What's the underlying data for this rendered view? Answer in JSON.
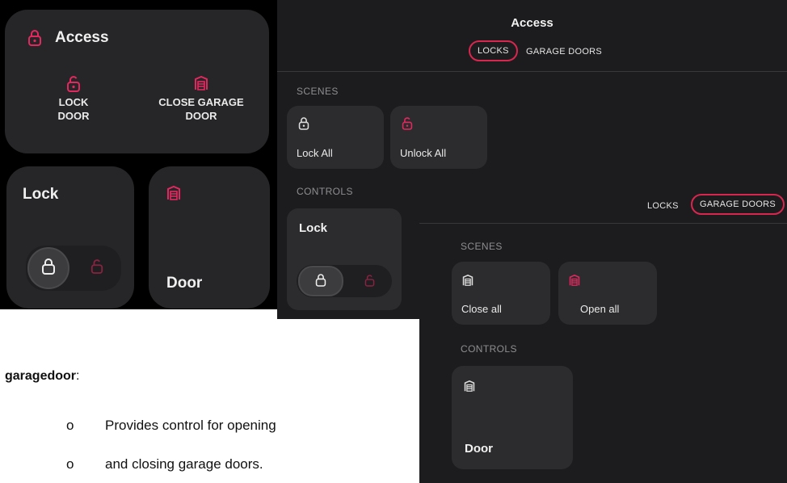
{
  "panelA": {
    "title": "Access",
    "actions": [
      {
        "label_line1": "LOCK",
        "label_line2": "DOOR",
        "icon": "lock-open-icon"
      },
      {
        "label_line1": "CLOSE GARAGE",
        "label_line2": "DOOR",
        "icon": "garage-icon"
      }
    ],
    "lock_card_title": "Lock",
    "door_card_title": "Door"
  },
  "panelB": {
    "title": "Access",
    "tabs": [
      "LOCKS",
      "GARAGE DOORS"
    ],
    "active_tab": "LOCKS",
    "scenes_header": "SCENES",
    "scenes": [
      "Lock All",
      "Unlock All"
    ],
    "controls_header": "CONTROLS",
    "control_title": "Lock"
  },
  "panelC": {
    "tabs": [
      "LOCKS",
      "GARAGE DOORS"
    ],
    "active_tab": "GARAGE DOORS",
    "scenes_header": "SCENES",
    "scenes": [
      "Close all",
      "Open all"
    ],
    "controls_header": "CONTROLS",
    "control_title": "Door"
  },
  "doc": {
    "term": "garagedoor",
    "bullets": [
      "Provides control for opening",
      "and closing garage doors."
    ]
  },
  "colors": {
    "accent": "#e3285f",
    "card": "#2c2c2e",
    "panel": "#1c1c1e"
  }
}
